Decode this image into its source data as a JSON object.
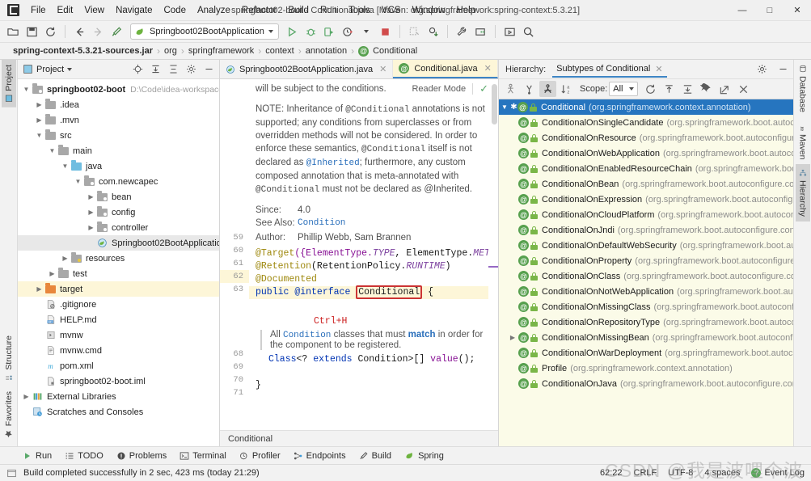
{
  "window": {
    "title": "springboot02-boot - Conditional.java [Maven: org.springframework:spring-context:5.3.21]",
    "minimize": "—",
    "maximize": "□",
    "close": "✕"
  },
  "menubar": {
    "items": [
      "File",
      "Edit",
      "View",
      "Navigate",
      "Code",
      "Analyze",
      "Refactor",
      "Build",
      "Run",
      "Tools",
      "VCS",
      "Window",
      "Help"
    ]
  },
  "toolbar": {
    "run_config": "Springboot02BootApplication",
    "icons": [
      "open-folder-icon",
      "save-icon",
      "sync-icon",
      "back-arrow-icon",
      "forward-arrow-icon",
      "build-hammer-icon",
      "run-icon",
      "debug-icon",
      "run-coverage-icon",
      "profiler-icon",
      "stop-icon",
      "update-project-icon",
      "commit-icon",
      "wrench-icon",
      "project-structure-icon",
      "presentation-icon",
      "search-everywhere-icon"
    ]
  },
  "breadcrumb": {
    "items": [
      "spring-context-5.3.21-sources.jar",
      "org",
      "springframework",
      "context",
      "annotation",
      "Conditional"
    ],
    "separator": "›"
  },
  "left_stripe": {
    "top": [
      {
        "label": "Project",
        "icon": "project-icon",
        "active": true
      }
    ],
    "bottom": [
      {
        "label": "Structure",
        "icon": "structure-icon",
        "active": false
      },
      {
        "label": "Favorites",
        "icon": "star-icon",
        "active": false
      }
    ]
  },
  "right_stripe": {
    "items": [
      {
        "label": "Database",
        "icon": "database-icon",
        "active": false
      },
      {
        "label": "Maven",
        "icon": "maven-icon",
        "active": false
      },
      {
        "label": "Hierarchy",
        "icon": "hierarchy-icon",
        "active": true
      }
    ]
  },
  "project_panel": {
    "title": "Project",
    "toolbar_icons": [
      "locate-icon",
      "expand-all-icon",
      "collapse-all-icon",
      "settings-gear-icon",
      "hide-icon"
    ],
    "tree": [
      {
        "depth": 0,
        "arrow": "down",
        "icon": "module-folder",
        "label": "springboot02-boot",
        "bold": true,
        "path": "D:\\Code\\idea-workspace",
        "state": "normal"
      },
      {
        "depth": 1,
        "arrow": "right",
        "icon": "folder-gray",
        "label": ".idea",
        "state": "normal"
      },
      {
        "depth": 1,
        "arrow": "right",
        "icon": "folder-gray",
        "label": ".mvn",
        "state": "normal"
      },
      {
        "depth": 1,
        "arrow": "down",
        "icon": "folder-gray",
        "label": "src",
        "state": "normal"
      },
      {
        "depth": 2,
        "arrow": "down",
        "icon": "folder-gray",
        "label": "main",
        "state": "normal"
      },
      {
        "depth": 3,
        "arrow": "down",
        "icon": "folder-blue",
        "label": "java",
        "state": "normal"
      },
      {
        "depth": 4,
        "arrow": "down",
        "icon": "package-icon",
        "label": "com.newcapec",
        "state": "normal"
      },
      {
        "depth": 5,
        "arrow": "right",
        "icon": "package-icon",
        "label": "bean",
        "state": "normal"
      },
      {
        "depth": 5,
        "arrow": "right",
        "icon": "package-icon",
        "label": "config",
        "state": "normal"
      },
      {
        "depth": 5,
        "arrow": "right",
        "icon": "package-icon",
        "label": "controller",
        "state": "normal"
      },
      {
        "depth": 5,
        "arrow": "none",
        "icon": "spring-class-icon",
        "label": "Springboot02BootApplicatio",
        "state": "selected"
      },
      {
        "depth": 3,
        "arrow": "right",
        "icon": "resources-icon",
        "label": "resources",
        "state": "normal"
      },
      {
        "depth": 2,
        "arrow": "right",
        "icon": "folder-gray",
        "label": "test",
        "state": "normal"
      },
      {
        "depth": 1,
        "arrow": "right",
        "icon": "folder-orange",
        "label": "target",
        "state": "highlight"
      },
      {
        "depth": 1,
        "arrow": "none",
        "icon": "gitignore-icon",
        "label": ".gitignore",
        "state": "normal"
      },
      {
        "depth": 1,
        "arrow": "none",
        "icon": "markdown-icon",
        "label": "HELP.md",
        "state": "normal"
      },
      {
        "depth": 1,
        "arrow": "none",
        "icon": "script-icon",
        "label": "mvnw",
        "state": "normal"
      },
      {
        "depth": 1,
        "arrow": "none",
        "icon": "cmd-icon",
        "label": "mvnw.cmd",
        "state": "normal"
      },
      {
        "depth": 1,
        "arrow": "none",
        "icon": "maven-pom-icon",
        "label": "pom.xml",
        "state": "normal"
      },
      {
        "depth": 1,
        "arrow": "none",
        "icon": "iml-icon",
        "label": "springboot02-boot.iml",
        "state": "normal"
      },
      {
        "depth": 0,
        "arrow": "right",
        "icon": "libraries-icon",
        "label": "External Libraries",
        "state": "normal"
      },
      {
        "depth": 0,
        "arrow": "none",
        "icon": "scratches-icon",
        "label": "Scratches and Consoles",
        "state": "normal"
      }
    ]
  },
  "editor": {
    "tabs": [
      {
        "label": "Springboot02BootApplication.java",
        "icon": "spring-class-icon",
        "active": false,
        "close": "✕"
      },
      {
        "label": "Conditional.java",
        "icon": "annotation-icon",
        "active": true,
        "close": "✕"
      }
    ],
    "reader_mode": "Reader Mode",
    "reader_check": "✓",
    "doc": {
      "lines": [
        "will be subject to the conditions.",
        "NOTE: Inheritance of @Conditional annotations is not",
        "supported; any conditions from superclasses or from",
        "overridden methods will not be considered. In order to",
        "enforce these semantics, @Conditional itself is not",
        "declared as @Inherited; furthermore, any custom",
        "composed annotation that is meta-annotated with",
        "@Conditional must not be declared as @Inherited."
      ],
      "since_label": "Since:",
      "since_value": "4.0",
      "seealso_label": "See Also:",
      "seealso_value": "Condition",
      "author_label": "Author:",
      "author_value": "Phillip Webb, Sam Brannen"
    },
    "gutter_lines": [
      "59",
      "60",
      "61",
      "62",
      "63",
      "",
      "",
      "",
      "",
      "68",
      "69",
      "70",
      "71"
    ],
    "code": {
      "target_anno": "@Target",
      "target_args_open": "({ElementType.",
      "target_type": "TYPE",
      "target_mid": ", ElementType.",
      "target_method": "METHOD",
      "target_close": "})",
      "retention_anno": "@Retention",
      "retention_open": "(RetentionPolicy.",
      "retention_value": "RUNTIME",
      "retention_close": ")",
      "documented": "@Documented",
      "decl_public": "public",
      "decl_interface": "@interface",
      "decl_name": "Conditional",
      "decl_brace": "{",
      "hint_shortcut": "Ctrl+H",
      "member_doc_1a": "All ",
      "member_doc_1b": "Condition",
      "member_doc_1c": " classes that must ",
      "member_doc_1d": "match",
      "member_doc_1e": " in order for",
      "member_doc_2": "the component to be registered.",
      "member_line": "Class<? extends Condition>[] value();",
      "closing_brace": "}"
    },
    "footer_breadcrumb": "Conditional"
  },
  "hierarchy": {
    "head_label": "Hierarchy:",
    "tab_label": "Subtypes of Conditional",
    "tab_close": "✕",
    "gear_icon": "settings-gear-icon",
    "hide_icon": "hide-icon",
    "toolbar": {
      "supertypes_icon": "supertypes-hierarchy-icon",
      "subtypes_icon": "subtypes-hierarchy-icon",
      "both_icon": "class-hierarchy-icon",
      "sort_icon": "sort-alphabetically-icon",
      "scope_label": "Scope:",
      "scope_value": "All",
      "refresh_icon": "refresh-icon",
      "export_icon": "export-icon",
      "expand_icon": "expand-all-icon",
      "pin_icon": "pin-icon",
      "open-in-new_icon": "open-in-new-window-icon",
      "close_icon": "close-icon"
    },
    "rows": [
      {
        "indent": 0,
        "arrow": "down",
        "star": true,
        "name": "Conditional",
        "pkg": "(org.springframework.context.annotation)",
        "selected": true
      },
      {
        "indent": 1,
        "arrow": "none",
        "star": false,
        "name": "ConditionalOnSingleCandidate",
        "pkg": "(org.springframework.boot.autoconfigu",
        "selected": false
      },
      {
        "indent": 1,
        "arrow": "none",
        "star": false,
        "name": "ConditionalOnResource",
        "pkg": "(org.springframework.boot.autoconfigure.cond",
        "selected": false
      },
      {
        "indent": 1,
        "arrow": "none",
        "star": false,
        "name": "ConditionalOnWebApplication",
        "pkg": "(org.springframework.boot.autoconfigur",
        "selected": false
      },
      {
        "indent": 1,
        "arrow": "none",
        "star": false,
        "name": "ConditionalOnEnabledResourceChain",
        "pkg": "(org.springframework.boot.autoc",
        "selected": false
      },
      {
        "indent": 1,
        "arrow": "none",
        "star": false,
        "name": "ConditionalOnBean",
        "pkg": "(org.springframework.boot.autoconfigure.condition",
        "selected": false
      },
      {
        "indent": 1,
        "arrow": "none",
        "star": false,
        "name": "ConditionalOnExpression",
        "pkg": "(org.springframework.boot.autoconfigure.con",
        "selected": false
      },
      {
        "indent": 1,
        "arrow": "none",
        "star": false,
        "name": "ConditionalOnCloudPlatform",
        "pkg": "(org.springframework.boot.autoconfigure",
        "selected": false
      },
      {
        "indent": 1,
        "arrow": "none",
        "star": false,
        "name": "ConditionalOnJndi",
        "pkg": "(org.springframework.boot.autoconfigure.condition)",
        "selected": false
      },
      {
        "indent": 1,
        "arrow": "none",
        "star": false,
        "name": "ConditionalOnDefaultWebSecurity",
        "pkg": "(org.springframework.boot.autoconf",
        "selected": false
      },
      {
        "indent": 1,
        "arrow": "none",
        "star": false,
        "name": "ConditionalOnProperty",
        "pkg": "(org.springframework.boot.autoconfigure.condi",
        "selected": false
      },
      {
        "indent": 1,
        "arrow": "none",
        "star": false,
        "name": "ConditionalOnClass",
        "pkg": "(org.springframework.boot.autoconfigure.condition",
        "selected": false
      },
      {
        "indent": 1,
        "arrow": "none",
        "star": false,
        "name": "ConditionalOnNotWebApplication",
        "pkg": "(org.springframework.boot.autoconf",
        "selected": false
      },
      {
        "indent": 1,
        "arrow": "none",
        "star": false,
        "name": "ConditionalOnMissingClass",
        "pkg": "(org.springframework.boot.autoconfigure.c",
        "selected": false
      },
      {
        "indent": 1,
        "arrow": "none",
        "star": false,
        "name": "ConditionalOnRepositoryType",
        "pkg": "(org.springframework.boot.autoconfigur",
        "selected": false
      },
      {
        "indent": 1,
        "arrow": "right",
        "star": false,
        "name": "ConditionalOnMissingBean",
        "pkg": "(org.springframework.boot.autoconfigure.c",
        "selected": false
      },
      {
        "indent": 1,
        "arrow": "none",
        "star": false,
        "name": "ConditionalOnWarDeployment",
        "pkg": "(org.springframework.boot.autoconfigu",
        "selected": false
      },
      {
        "indent": 1,
        "arrow": "none",
        "star": false,
        "name": "Profile",
        "pkg": "(org.springframework.context.annotation)",
        "selected": false
      },
      {
        "indent": 1,
        "arrow": "none",
        "star": false,
        "name": "ConditionalOnJava",
        "pkg": "(org.springframework.boot.autoconfigure.condition)",
        "selected": false
      }
    ]
  },
  "toolwindow_bar": {
    "items": [
      {
        "label": "Run",
        "icon": "run-icon"
      },
      {
        "label": "TODO",
        "icon": "todo-icon"
      },
      {
        "label": "Problems",
        "icon": "problems-icon"
      },
      {
        "label": "Terminal",
        "icon": "terminal-icon"
      },
      {
        "label": "Profiler",
        "icon": "profiler-icon"
      },
      {
        "label": "Endpoints",
        "icon": "endpoints-icon"
      },
      {
        "label": "Build",
        "icon": "build-hammer-icon"
      },
      {
        "label": "Spring",
        "icon": "spring-leaf-icon"
      }
    ]
  },
  "statusbar": {
    "message": "Build completed successfully in 2 sec, 423 ms (today 21:29)",
    "message_icon": "build-window-icon",
    "caret_position": "62:22",
    "line_separator": "CRLF",
    "encoding": "UTF-8",
    "indent": "4 spaces",
    "event_log": "Event Log",
    "watermark": "CSDN @我是波哩个波"
  },
  "colors": {
    "accent_blue": "#2675bf",
    "selection_yellow": "#fdf6d8",
    "hierarchy_bg": "#fbfbe8",
    "green_icon": "#57a04e",
    "red_hint": "#cc2020",
    "annotation_gold": "#9e880d",
    "keyword_blue": "#0033b3"
  }
}
